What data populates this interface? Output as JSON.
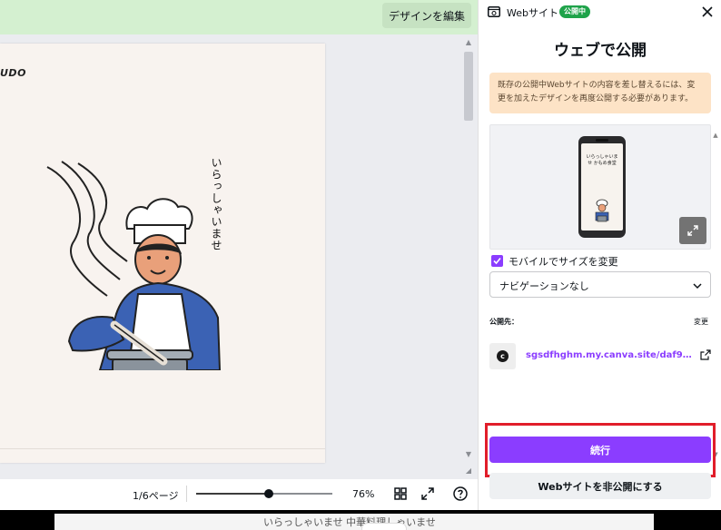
{
  "editor": {
    "top_button_label": "デザインを編集",
    "page_logo": "UDO",
    "vertical_text": "いらっしゃいませ",
    "status": {
      "page_indicator": "1/6ページ",
      "zoom_label": "76%",
      "zoom_fraction": 0.53
    },
    "bottom_text": "いらっしゃいませ 中華料理しゃいませ"
  },
  "panel": {
    "header_title": "Webサイト",
    "header_badge": "公開中",
    "title": "ウェブで公開",
    "notice": "既存の公開中Webサイトの内容を差し替えるには、変更を加えたデザインを再度公開する必要があります。",
    "preview_phone_text": "いらっしゃいませ かもめ食堂",
    "mobile_resize_label": "モバイルでサイズを変更",
    "mobile_resize_checked": true,
    "navigation_select": "ナビゲーションなし",
    "publish_to_label": "公開先：",
    "change_label": "変更",
    "site_url": "sgsdfhghm.my.canva.site/daf9bljf...",
    "continue_label": "続行",
    "unpublish_label": "Webサイトを非公開にする"
  },
  "colors": {
    "accent": "#8b3dff",
    "badge": "#1fa34a",
    "notice_bg": "#fde3c6",
    "highlight": "#e11d2a",
    "topbar": "#d4f0d0"
  },
  "icons": [
    "website-icon",
    "close-icon",
    "expand-icon",
    "chevron-down-icon",
    "external-link-icon",
    "grid-icon",
    "fullscreen-icon",
    "help-icon"
  ]
}
